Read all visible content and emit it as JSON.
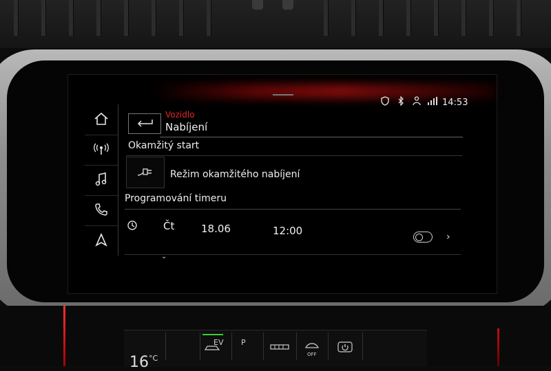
{
  "header": {
    "parent_label": "Vozidlo",
    "title": "Nabíjení"
  },
  "status_bar": {
    "time": "14:53",
    "icons": [
      "shield-icon",
      "bluetooth-icon",
      "person-icon",
      "lte-signal-icon"
    ]
  },
  "side_menu": [
    {
      "name": "home-icon"
    },
    {
      "name": "radio-icon"
    },
    {
      "name": "music-icon"
    },
    {
      "name": "phone-icon"
    },
    {
      "name": "navigation-icon"
    }
  ],
  "sections": {
    "instant_start": "Okamžitý start",
    "instant_mode_label": "Režim okamžitého nabíjení",
    "timer_programming": "Programování timeru"
  },
  "timer_row": {
    "day": "Čt",
    "date": "18.06",
    "time": "12:00",
    "enabled": false
  },
  "climate": {
    "temperature": "16",
    "unit": "°C",
    "ev_label": "EV",
    "off_label": "OFF",
    "p_label": "P"
  },
  "colors": {
    "accent_red": "#e8242b",
    "screen_bg": "#000000"
  }
}
